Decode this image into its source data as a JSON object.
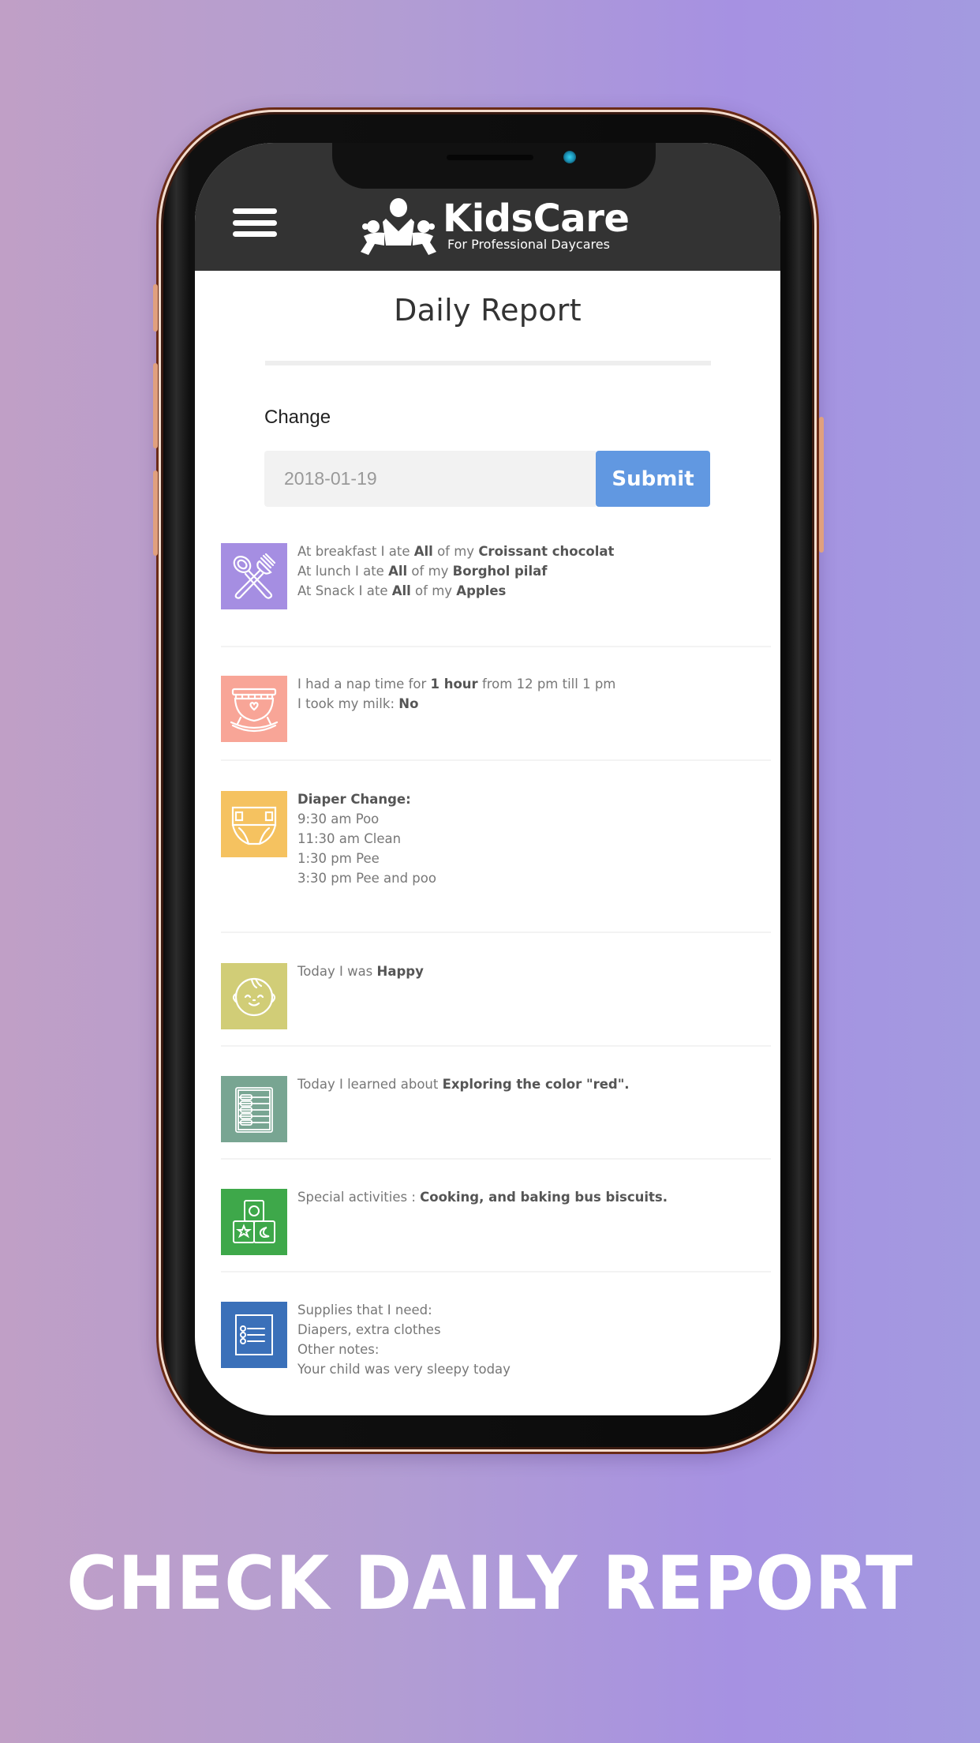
{
  "app": {
    "name": "KidsCare",
    "tagline": "For Professional Daycares",
    "menu_icon": "hamburger-menu-icon",
    "logo_icon": "kids-group-logo-icon"
  },
  "page": {
    "title": "Daily Report",
    "change_label": "Change",
    "date_value": "2018-01-19",
    "submit_label": "Submit"
  },
  "colors": {
    "header_bg": "#333333",
    "submit_bg": "#6198e1",
    "meals": "#a58ee2",
    "nap": "#f8a597",
    "diaper": "#f5c260",
    "mood": "#d1cd77",
    "learning": "#78a592",
    "activities": "#3ea84a",
    "supplies": "#3a70b9"
  },
  "entries": [
    {
      "id": "meals",
      "icon": "utensils-icon",
      "lines": [
        [
          {
            "t": "At breakfast I ate "
          },
          {
            "t": "All",
            "b": true
          },
          {
            "t": " of my "
          },
          {
            "t": "Croissant chocolat",
            "b": true
          }
        ],
        [
          {
            "t": "At lunch I ate "
          },
          {
            "t": "All",
            "b": true
          },
          {
            "t": " of my "
          },
          {
            "t": "Borghol pilaf",
            "b": true
          }
        ],
        [
          {
            "t": "At Snack I ate "
          },
          {
            "t": "All",
            "b": true
          },
          {
            "t": " of my "
          },
          {
            "t": "Apples",
            "b": true
          }
        ]
      ]
    },
    {
      "id": "nap",
      "icon": "cradle-icon",
      "lines": [
        [
          {
            "t": "I had a nap time for "
          },
          {
            "t": "1 hour",
            "b": true
          },
          {
            "t": " from 12 pm till 1 pm"
          }
        ],
        [
          {
            "t": "I took my milk: "
          },
          {
            "t": "No",
            "b": true
          }
        ]
      ]
    },
    {
      "id": "diaper",
      "icon": "diaper-icon",
      "lines": [
        [
          {
            "t": "Diaper Change:",
            "b": true
          }
        ],
        [
          {
            "t": "9:30 am Poo"
          }
        ],
        [
          {
            "t": "11:30 am Clean"
          }
        ],
        [
          {
            "t": "1:30 pm Pee"
          }
        ],
        [
          {
            "t": "3:30 pm Pee and poo"
          }
        ]
      ]
    },
    {
      "id": "mood",
      "icon": "baby-face-icon",
      "lines": [
        [
          {
            "t": "Today I was "
          },
          {
            "t": "Happy",
            "b": true
          }
        ]
      ]
    },
    {
      "id": "learning",
      "icon": "abacus-icon",
      "lines": [
        [
          {
            "t": "Today I learned about "
          },
          {
            "t": "Exploring the color \"red\".",
            "b": true
          }
        ]
      ]
    },
    {
      "id": "activities",
      "icon": "toy-blocks-icon",
      "lines": [
        [
          {
            "t": "Special activities : "
          },
          {
            "t": "Cooking, and baking bus biscuits.",
            "b": true
          }
        ]
      ]
    },
    {
      "id": "supplies",
      "icon": "checklist-icon",
      "lines": [
        [
          {
            "t": "Supplies that I need:"
          }
        ],
        [
          {
            "t": "Diapers, extra clothes"
          }
        ],
        [
          {
            "t": "Other notes:"
          }
        ],
        [
          {
            "t": "Your child was very sleepy today"
          }
        ]
      ]
    }
  ],
  "banner": {
    "text": "CHECK DAILY REPORT"
  }
}
